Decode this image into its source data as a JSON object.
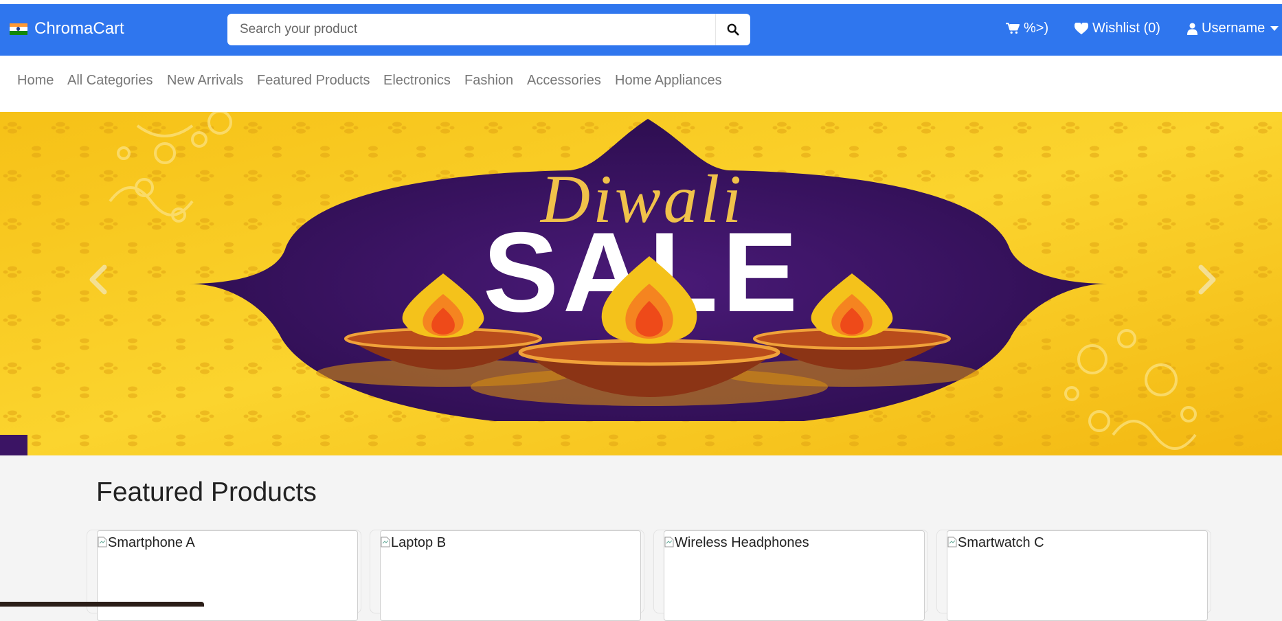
{
  "brand": {
    "name": "ChromaCart",
    "flag_icon": "india-flag-icon"
  },
  "search": {
    "placeholder": "Search your product",
    "value": "",
    "button_icon": "search-icon"
  },
  "header": {
    "cart_label": "%>)",
    "wishlist_label": "Wishlist (0)",
    "user_label": "Username",
    "accent": "#2f76ee"
  },
  "categories": [
    "Home",
    "All Categories",
    "New Arrivals",
    "Featured Products",
    "Electronics",
    "Fashion",
    "Accessories",
    "Home Appliances"
  ],
  "carousel": {
    "banner_line1": "Diwali",
    "banner_line2": "SALE",
    "prev_icon": "chevron-left-icon",
    "next_icon": "chevron-right-icon"
  },
  "featured": {
    "title": "Featured Products",
    "products": [
      {
        "alt": "Smartphone A"
      },
      {
        "alt": "Laptop B"
      },
      {
        "alt": "Wireless Headphones"
      },
      {
        "alt": "Smartwatch C"
      }
    ]
  }
}
